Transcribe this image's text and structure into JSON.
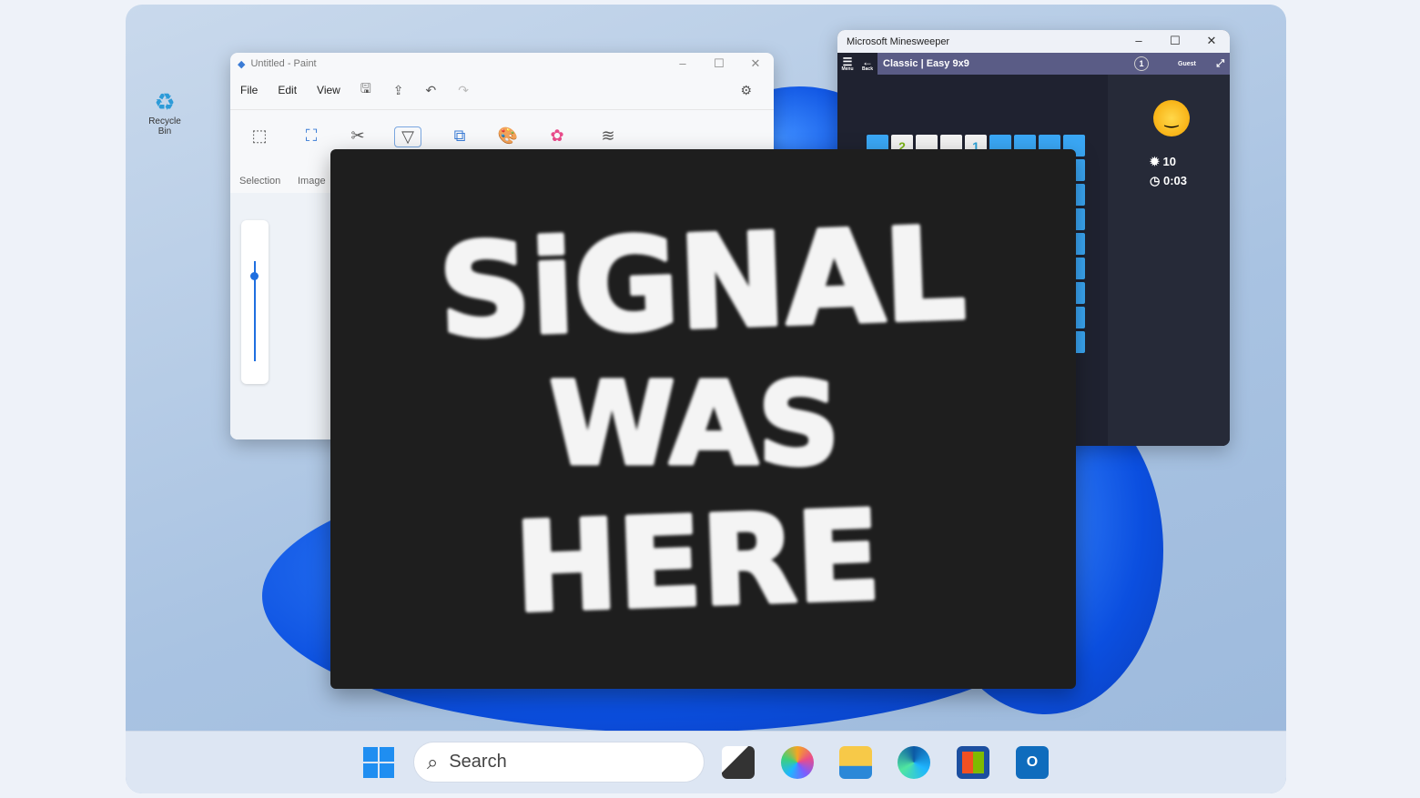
{
  "desktop": {
    "recycle_bin": "Recycle Bin"
  },
  "paint": {
    "title": "Untitled - Paint",
    "menu": [
      "File",
      "Edit",
      "View"
    ],
    "ribbon_labels": [
      "Selection",
      "Image"
    ],
    "controls": [
      "–",
      "☐",
      "✕"
    ]
  },
  "minesweeper": {
    "title": "Microsoft Minesweeper",
    "mode": "Classic | Easy 9x9",
    "menu_label": "Menu",
    "back_label": "Back",
    "guest_label": "Guest",
    "level": "1",
    "mines": "10",
    "time": "0:03",
    "first_row": [
      "",
      "2",
      "",
      "",
      "1",
      "",
      "",
      "",
      ""
    ],
    "controls": [
      "–",
      "☐",
      "✕"
    ]
  },
  "overlay": {
    "lines": [
      "SiGNAL",
      "WAS",
      "HERE"
    ]
  },
  "taskbar": {
    "search_placeholder": "Search"
  }
}
